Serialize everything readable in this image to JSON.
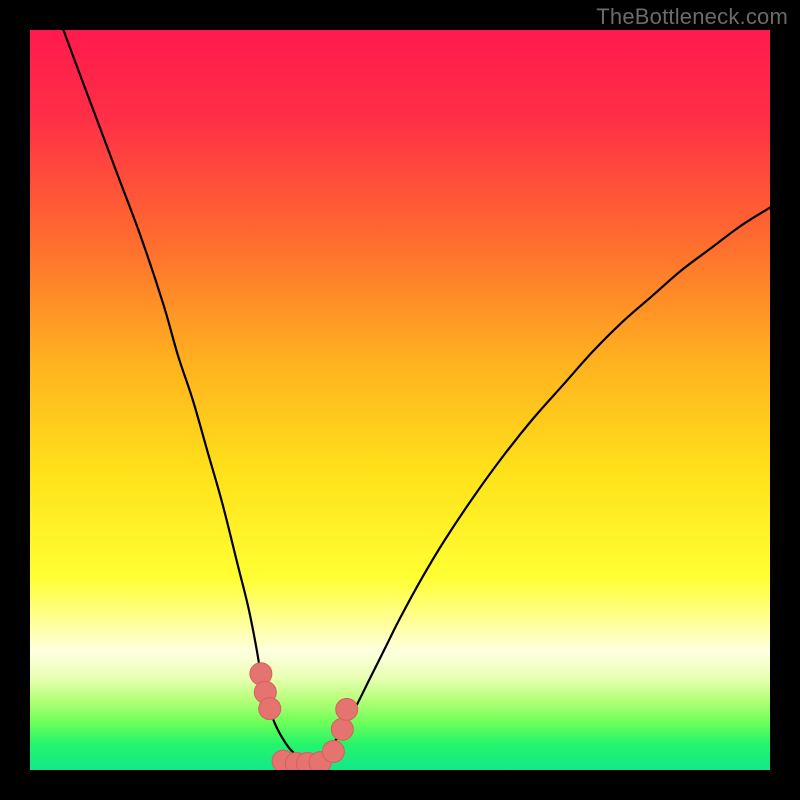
{
  "watermark": "TheBottleneck.com",
  "colors": {
    "frame": "#000000",
    "gradient_stops": [
      {
        "offset": 0.0,
        "color": "#ff1a4d"
      },
      {
        "offset": 0.12,
        "color": "#ff2f47"
      },
      {
        "offset": 0.28,
        "color": "#ff6a2f"
      },
      {
        "offset": 0.45,
        "color": "#ffb21f"
      },
      {
        "offset": 0.6,
        "color": "#ffe21a"
      },
      {
        "offset": 0.74,
        "color": "#ffff33"
      },
      {
        "offset": 0.8,
        "color": "#ffff99"
      },
      {
        "offset": 0.84,
        "color": "#ffffe0"
      },
      {
        "offset": 0.875,
        "color": "#e9ffb3"
      },
      {
        "offset": 0.905,
        "color": "#b6ff7a"
      },
      {
        "offset": 0.935,
        "color": "#6fff5a"
      },
      {
        "offset": 0.965,
        "color": "#24f56a"
      },
      {
        "offset": 1.0,
        "color": "#12e88a"
      }
    ],
    "curve": "#000000",
    "marker_fill": "#e5736f",
    "marker_stroke": "#d85f5b"
  },
  "chart_data": {
    "type": "line",
    "title": "",
    "xlabel": "",
    "ylabel": "",
    "xlim": [
      0,
      100
    ],
    "ylim": [
      0,
      100
    ],
    "note": "Values estimated visually from the image — axes are unlabeled, so x and y are in percent of the plot area (x: left→right, y: bottom→top).",
    "series": [
      {
        "name": "left-branch",
        "x": [
          0,
          3,
          6,
          9,
          12,
          15,
          18,
          20,
          22,
          24,
          26,
          28,
          29.5,
          30.5,
          31.2,
          31.8,
          32.4,
          33,
          34,
          35,
          36,
          37,
          38
        ],
        "y": [
          111,
          104,
          96,
          88,
          80,
          72,
          63,
          56,
          50,
          43,
          36,
          28,
          22,
          17,
          13,
          10.5,
          8.3,
          6.5,
          4.5,
          3,
          2,
          1.3,
          1
        ]
      },
      {
        "name": "right-branch",
        "x": [
          38,
          40,
          42,
          44,
          46,
          48,
          50,
          53,
          56,
          60,
          64,
          68,
          72,
          76,
          80,
          84,
          88,
          92,
          96,
          100
        ],
        "y": [
          1,
          2.5,
          5,
          8.5,
          12.5,
          16.5,
          20.5,
          26,
          31,
          37,
          42.5,
          47.5,
          52,
          56.5,
          60.5,
          64,
          67.5,
          70.5,
          73.5,
          76
        ]
      },
      {
        "name": "valley-markers",
        "x": [
          31.2,
          31.8,
          32.4,
          34.2,
          36.0,
          37.5,
          39.2,
          41.0,
          42.2,
          42.8
        ],
        "y": [
          13.0,
          10.5,
          8.3,
          1.2,
          0.9,
          0.9,
          1.0,
          2.5,
          5.5,
          8.2
        ]
      }
    ]
  }
}
